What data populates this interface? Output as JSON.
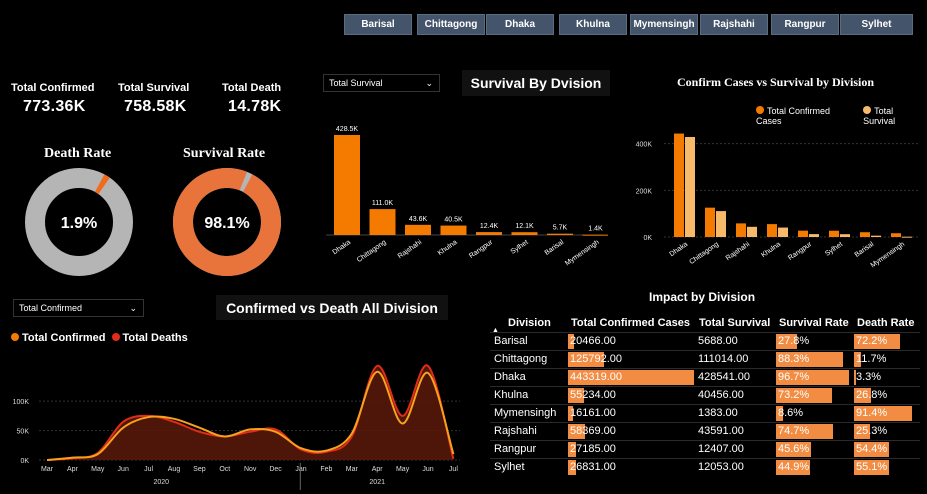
{
  "slicers": [
    "Barisal",
    "Chittagong",
    "Dhaka",
    "Khulna",
    "Mymensingh",
    "Rajshahi",
    "Rangpur",
    "Sylhet"
  ],
  "kpis": [
    {
      "label": "Total Confirmed",
      "value": "773.36K"
    },
    {
      "label": "Total Survival",
      "value": "758.58K"
    },
    {
      "label": "Total Death",
      "value": "14.78K"
    }
  ],
  "gauges": {
    "death": {
      "title": "Death Rate",
      "value_label": "1.9%",
      "value": 0.019,
      "fill_color": "#f26b1d",
      "track_color": "#b5b5b5"
    },
    "survival": {
      "title": "Survival Rate",
      "value_label": "98.1%",
      "value": 0.981,
      "fill_color": "#e8743b",
      "track_color": "#b5b5b5"
    }
  },
  "dropdowns": {
    "survival": "Total Survival",
    "confirmed": "Total Confirmed"
  },
  "titles": {
    "survival_by_division": "Survival By Dvision",
    "confirm_vs_survival": "Confirm Cases vs Survival by Division",
    "confirmed_vs_death": "Confirmed vs Death All Division",
    "impact": "Impact by Division"
  },
  "legends": {
    "confirm_vs_survival": [
      "Total Confirmed Cases",
      "Total Survival"
    ],
    "confirmed_vs_death": [
      "Total Confirmed",
      "Total Deaths"
    ]
  },
  "colors": {
    "orange": "#f47b00",
    "light_orange": "#f7b96a",
    "red": "#e32b1a",
    "line_orange": "#f7a21b",
    "table_bar": "#f28c43"
  },
  "chart_data": [
    {
      "type": "bar",
      "title": "Survival By Dvision",
      "categories": [
        "Dhaka",
        "Chittagong",
        "Rajshahi",
        "Khulna",
        "Rangpur",
        "Sylhet",
        "Barisal",
        "Mymensingh"
      ],
      "values": [
        428541,
        111014,
        43591,
        40456,
        12407,
        12053,
        5688,
        1383
      ],
      "data_labels": [
        "428.5K",
        "111.0K",
        "43.6K",
        "40.5K",
        "12.4K",
        "12.1K",
        "5.7K",
        "1.4K"
      ]
    },
    {
      "type": "bar",
      "title": "Confirm Cases vs Survival by Division",
      "categories": [
        "Dhaka",
        "Chittagong",
        "Rajshahi",
        "Khulna",
        "Rangpur",
        "Sylhet",
        "Barisal",
        "Mymensingh"
      ],
      "series": [
        {
          "name": "Total Confirmed Cases",
          "values": [
            443319,
            125792,
            58369,
            55234,
            27185,
            26831,
            20466,
            16161
          ]
        },
        {
          "name": "Total Survival",
          "values": [
            428541,
            111014,
            43591,
            40456,
            12407,
            12053,
            5688,
            1383
          ]
        }
      ],
      "yticks": [
        "0K",
        "200K",
        "400K"
      ],
      "ylim": [
        0,
        480000
      ],
      "legend": "top-right"
    },
    {
      "type": "area",
      "title": "Confirmed vs Death All Division",
      "x": [
        "Mar",
        "Apr",
        "May",
        "Jun",
        "Jul",
        "Aug",
        "Sep",
        "Oct",
        "Nov",
        "Dec",
        "Jan",
        "Feb",
        "Mar",
        "Apr",
        "May",
        "Jun",
        "Jul"
      ],
      "year_labels": [
        "2020",
        "2021"
      ],
      "series": [
        {
          "name": "Total Confirmed",
          "values": [
            0,
            4000,
            10000,
            55000,
            73000,
            70000,
            55000,
            40000,
            52000,
            48000,
            20000,
            16000,
            45000,
            150000,
            62000,
            148000,
            10000
          ]
        },
        {
          "name": "Total Deaths",
          "values": [
            0,
            3000,
            12000,
            65000,
            75000,
            65000,
            48000,
            40000,
            48000,
            52000,
            18000,
            14000,
            40000,
            160000,
            75000,
            160000,
            2000
          ]
        }
      ],
      "yticks": [
        "0K",
        "50K",
        "100K"
      ],
      "ylim": [
        0,
        170000
      ],
      "legend": "top-left"
    }
  ],
  "table": {
    "headers": [
      "Division",
      "Total Confirmed Cases",
      "Total Survival",
      "Survival Rate",
      "Death Rate"
    ],
    "rows": [
      {
        "division": "Barisal",
        "confirmed": "20466.00",
        "survival": "5688.00",
        "survival_rate": "27.8%",
        "death_rate": "72.2%",
        "c": 20466,
        "s": 5688,
        "sr": 27.8,
        "dr": 72.2
      },
      {
        "division": "Chittagong",
        "confirmed": "125792.00",
        "survival": "111014.00",
        "survival_rate": "88.3%",
        "death_rate": "11.7%",
        "c": 125792,
        "s": 111014,
        "sr": 88.3,
        "dr": 11.7
      },
      {
        "division": "Dhaka",
        "confirmed": "443319.00",
        "survival": "428541.00",
        "survival_rate": "96.7%",
        "death_rate": "3.3%",
        "c": 443319,
        "s": 428541,
        "sr": 96.7,
        "dr": 3.3
      },
      {
        "division": "Khulna",
        "confirmed": "55234.00",
        "survival": "40456.00",
        "survival_rate": "73.2%",
        "death_rate": "26.8%",
        "c": 55234,
        "s": 40456,
        "sr": 73.2,
        "dr": 26.8
      },
      {
        "division": "Mymensingh",
        "confirmed": "16161.00",
        "survival": "1383.00",
        "survival_rate": "8.6%",
        "death_rate": "91.4%",
        "c": 16161,
        "s": 1383,
        "sr": 8.6,
        "dr": 91.4
      },
      {
        "division": "Rajshahi",
        "confirmed": "58369.00",
        "survival": "43591.00",
        "survival_rate": "74.7%",
        "death_rate": "25.3%",
        "c": 58369,
        "s": 43591,
        "sr": 74.7,
        "dr": 25.3
      },
      {
        "division": "Rangpur",
        "confirmed": "27185.00",
        "survival": "12407.00",
        "survival_rate": "45.6%",
        "death_rate": "54.4%",
        "c": 27185,
        "s": 12407,
        "sr": 45.6,
        "dr": 54.4
      },
      {
        "division": "Sylhet",
        "confirmed": "26831.00",
        "survival": "12053.00",
        "survival_rate": "44.9%",
        "death_rate": "55.1%",
        "c": 26831,
        "s": 12053,
        "sr": 44.9,
        "dr": 55.1
      }
    ]
  }
}
